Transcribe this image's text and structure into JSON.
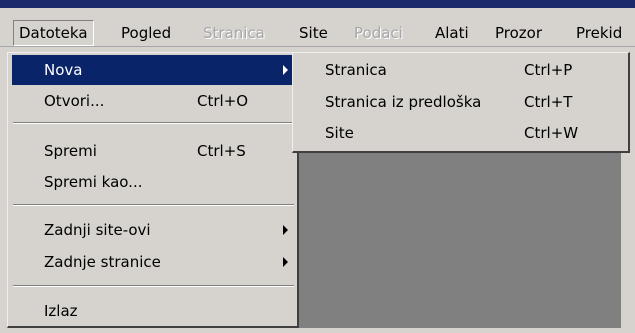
{
  "menubar": {
    "items": [
      {
        "label": "Datoteka",
        "state": "active"
      },
      {
        "label": "Pogled",
        "state": "normal"
      },
      {
        "label": "Stranica",
        "state": "disabled"
      },
      {
        "label": "Site",
        "state": "normal"
      },
      {
        "label": "Podaci",
        "state": "disabled"
      },
      {
        "label": "Alati",
        "state": "normal"
      },
      {
        "label": "Prozor",
        "state": "normal"
      },
      {
        "label": "Prekid",
        "state": "normal"
      }
    ]
  },
  "file_menu": {
    "items": [
      {
        "label": "Nova",
        "shortcut": "",
        "submenu": true,
        "highlighted": true
      },
      {
        "label": "Otvori...",
        "shortcut": "Ctrl+O"
      },
      {
        "label": "Spremi",
        "shortcut": "Ctrl+S"
      },
      {
        "label": "Spremi kao...",
        "shortcut": ""
      },
      {
        "label": "Zadnji site-ovi",
        "shortcut": "",
        "submenu": true
      },
      {
        "label": "Zadnje stranice",
        "shortcut": "",
        "submenu": true
      },
      {
        "label": "Izlaz",
        "shortcut": ""
      }
    ]
  },
  "new_submenu": {
    "items": [
      {
        "label": "Stranica",
        "shortcut": "Ctrl+P"
      },
      {
        "label": "Stranica iz predloška",
        "shortcut": "Ctrl+T"
      },
      {
        "label": "Site",
        "shortcut": "Ctrl+W"
      }
    ]
  },
  "colors": {
    "menu_face": "#d6d3ce",
    "highlight": "#0a246a",
    "workspace": "#808080",
    "disabled_text": "#a7a6aa"
  },
  "icons": {
    "submenu_arrow": "chevron-right-icon"
  }
}
